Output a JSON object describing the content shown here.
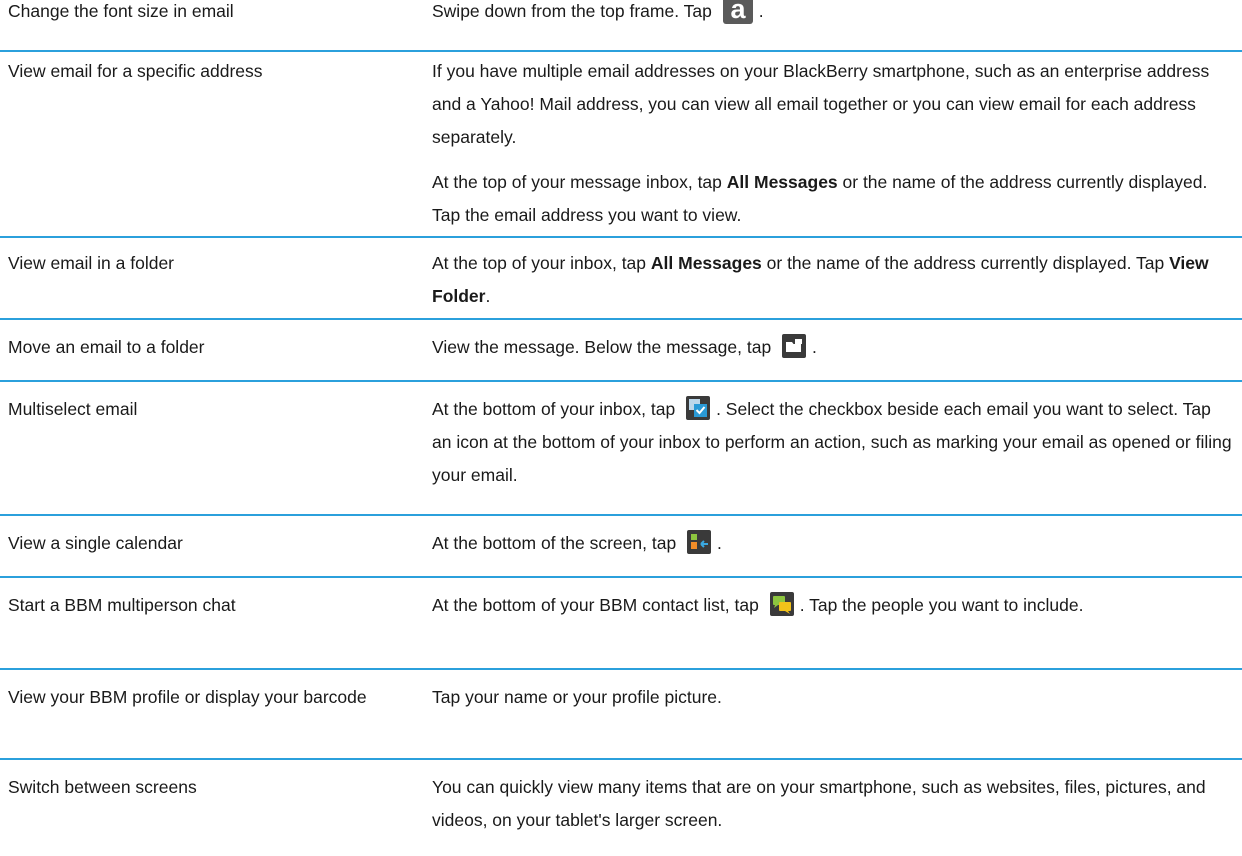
{
  "rows": [
    {
      "task": "Change the font size in email",
      "paras": [
        [
          {
            "t": "Swipe down from the top frame. Tap "
          },
          {
            "icon": "font-size-icon"
          },
          {
            "t": "."
          }
        ]
      ]
    },
    {
      "task": "View email for a specific address",
      "paras": [
        [
          {
            "t": "If you have multiple email addresses on your BlackBerry smartphone, such as an enterprise address and a Yahoo! Mail address, you can view all email together or you can view email for each address separately."
          }
        ],
        [
          {
            "t": "At the top of your message inbox, tap "
          },
          {
            "b": "All Messages"
          },
          {
            "t": " or the name of the address currently displayed. Tap the email address you want to view."
          }
        ]
      ]
    },
    {
      "task": "View email in a folder",
      "paras": [
        [
          {
            "t": "At the top of your inbox, tap "
          },
          {
            "b": "All Messages"
          },
          {
            "t": " or the name of the address currently displayed. Tap "
          },
          {
            "b": "View Folder"
          },
          {
            "t": "."
          }
        ]
      ]
    },
    {
      "task": "Move an email to a folder",
      "paras": [
        [
          {
            "t": "View the message. Below the message, tap "
          },
          {
            "icon": "file-folder-icon"
          },
          {
            "t": "."
          }
        ]
      ]
    },
    {
      "task": "Multiselect email",
      "paras": [
        [
          {
            "t": "At the bottom of your inbox, tap "
          },
          {
            "icon": "multiselect-icon"
          },
          {
            "t": ". Select the checkbox beside each email you want to select. Tap an icon at the bottom of your inbox to perform an action, such as marking your email as opened or filing your email."
          }
        ]
      ]
    },
    {
      "task": "View a single calendar",
      "paras": [
        [
          {
            "t": "At the bottom of the screen, tap "
          },
          {
            "icon": "calendar-toggle-icon"
          },
          {
            "t": "."
          }
        ]
      ]
    },
    {
      "task": "Start a BBM multiperson chat",
      "paras": [
        [
          {
            "t": "At the bottom of your BBM contact list, tap "
          },
          {
            "icon": "bbm-chat-icon"
          },
          {
            "t": ". Tap the people you want to include."
          }
        ]
      ]
    },
    {
      "task": "View your BBM profile or display your barcode",
      "paras": [
        [
          {
            "t": "Tap your name or your profile picture."
          }
        ]
      ]
    },
    {
      "task": "Switch between screens",
      "paras": [
        [
          {
            "t": "You can quickly view many items that are on your smartphone, such as websites, files, pictures, and videos, on your tablet's larger screen."
          }
        ]
      ]
    }
  ],
  "colors": {
    "divider": "#2ba0dc",
    "text": "#1a1a1a"
  }
}
